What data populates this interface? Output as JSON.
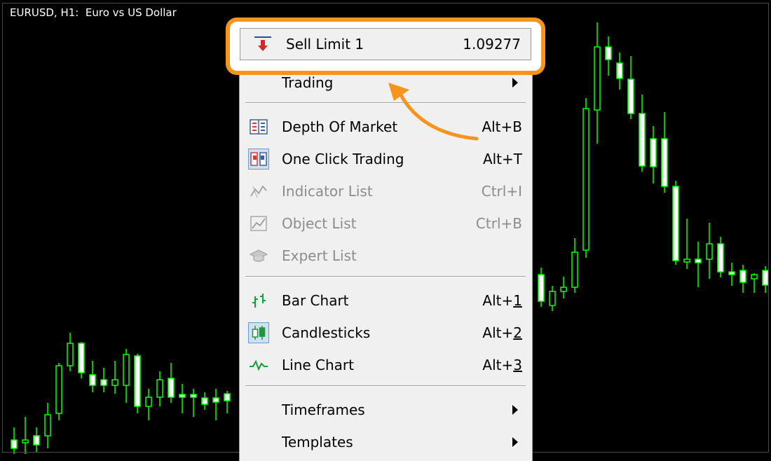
{
  "chart": {
    "title": "EURUSD, H1:  Euro vs US Dollar",
    "candle_color": "#00ff00",
    "background": "#000000"
  },
  "highlight": {
    "color": "#f7941d",
    "item": {
      "icon": "sell-limit-arrow-icon",
      "label": "Sell Limit 1",
      "value": "1.09277"
    }
  },
  "menu": {
    "items": [
      {
        "label": "Trading",
        "submenu": true
      },
      {
        "label": "Depth Of Market",
        "shortcut": "Alt+B",
        "icon": "depth-of-market-icon"
      },
      {
        "label": "One Click Trading",
        "shortcut": "Alt+T",
        "icon": "one-click-trading-icon",
        "checked": true
      },
      {
        "label": "Indicator List",
        "shortcut": "Ctrl+I",
        "icon": "indicator-list-icon",
        "disabled": true
      },
      {
        "label": "Object List",
        "shortcut": "Ctrl+B",
        "icon": "object-list-icon",
        "disabled": true
      },
      {
        "label": "Expert List",
        "shortcut": "",
        "icon": "expert-list-icon",
        "disabled": true
      },
      {
        "label": "Bar Chart",
        "shortcut_prefix": "Alt+",
        "shortcut_key": "1",
        "icon": "bar-chart-icon"
      },
      {
        "label": "Candlesticks",
        "shortcut_prefix": "Alt+",
        "shortcut_key": "2",
        "icon": "candlesticks-icon",
        "checked": true
      },
      {
        "label": "Line Chart",
        "shortcut_prefix": "Alt+",
        "shortcut_key": "3",
        "icon": "line-chart-icon"
      },
      {
        "label": "Timeframes",
        "submenu": true
      },
      {
        "label": "Templates",
        "submenu": true
      }
    ]
  }
}
